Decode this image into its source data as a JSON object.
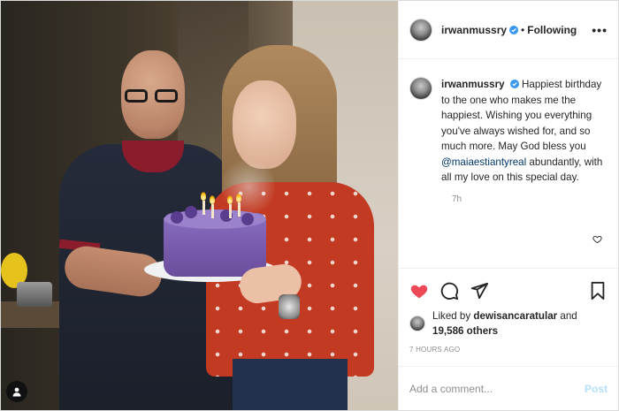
{
  "post": {
    "username": "irwanmussry",
    "follow_status": "Following",
    "separator": "•",
    "more_icon": "more-horizontal-icon",
    "caption_username": "irwanmussry",
    "caption_part1": "Happiest birthday to the one who makes me the happiest. Wishing you everything you've always wished for, and so much more. May God bless you",
    "caption_mention": "@maiaestiantyreal",
    "caption_part2": "abundantly, with all my love on this special day.",
    "caption_time": "7h",
    "liked_by_prefix": "Liked by",
    "liked_by_user": "dewisancaratular",
    "liked_by_and": "and",
    "likes_count": "19,586 others",
    "posted_time": "7 HOURS AGO",
    "comment_placeholder": "Add a comment...",
    "post_label": "Post",
    "liked": true
  },
  "colors": {
    "like_red": "#ed4956",
    "verified_blue": "#3897f0",
    "link_blue": "#00376b",
    "post_disabled": "#b2dffc"
  }
}
